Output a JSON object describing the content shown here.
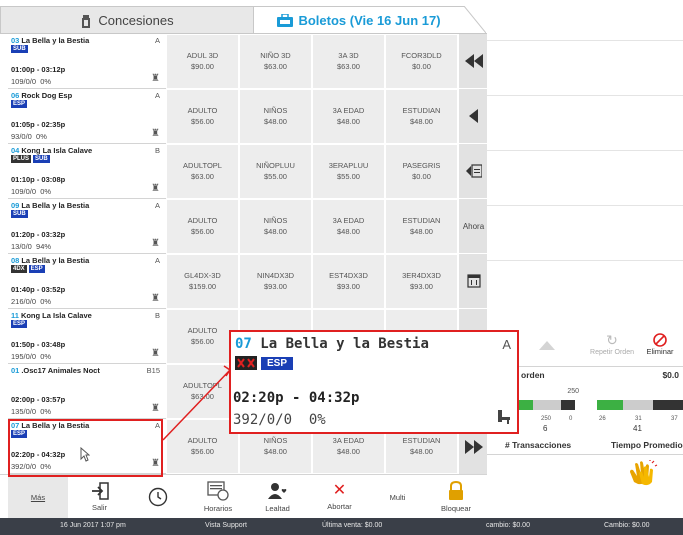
{
  "tabs": {
    "concessions": "Concesiones",
    "tickets": "Boletos (Vie 16 Jun 17)"
  },
  "showings": [
    {
      "num": "03",
      "title": "La Bella y la Bestia",
      "rating": "A",
      "tags": [
        "SUB"
      ],
      "time": "01:00p - 03:12p",
      "occupancy": "109/0/0  0%"
    },
    {
      "num": "06",
      "title": "Rock Dog Esp",
      "rating": "A",
      "tags": [
        "ESP"
      ],
      "time": "01:05p - 02:35p",
      "occupancy": "93/0/0  0%"
    },
    {
      "num": "04",
      "title": "Kong La Isla Calave",
      "rating": "B",
      "tags": [
        "PLUS",
        "SUB"
      ],
      "time": "01:10p - 03:08p",
      "occupancy": "109/0/0  0%"
    },
    {
      "num": "09",
      "title": "La Bella y la Bestia",
      "rating": "A",
      "tags": [
        "SUB"
      ],
      "time": "01:20p - 03:32p",
      "occupancy": "13/0/0  94%"
    },
    {
      "num": "08",
      "title": "La Bella y la Bestia",
      "rating": "A",
      "tags": [
        "4DX",
        "ESP"
      ],
      "time": "01:40p - 03:52p",
      "occupancy": "216/0/0  0%"
    },
    {
      "num": "11",
      "title": "Kong La Isla Calave",
      "rating": "B",
      "tags": [
        "ESP"
      ],
      "time": "01:50p - 03:48p",
      "occupancy": "195/0/0  0%"
    },
    {
      "num": "01",
      "title": ".Osc17 Animales Noct",
      "rating": "B15",
      "tags": [],
      "time": "02:00p - 03:57p",
      "occupancy": "135/0/0  0%"
    },
    {
      "num": "07",
      "title": "La Bella y la Bestia",
      "rating": "A",
      "tags": [
        "ESP"
      ],
      "time": "02:20p - 04:32p",
      "occupancy": "392/0/0  0%"
    }
  ],
  "prices": [
    [
      {
        "name": "ADUL 3D",
        "price": "$90.00"
      },
      {
        "name": "NIÑO 3D",
        "price": "$63.00"
      },
      {
        "name": "3A 3D",
        "price": "$63.00"
      },
      {
        "name": "FCOR3DLD",
        "price": "$0.00"
      }
    ],
    [
      {
        "name": "ADULTO",
        "price": "$56.00"
      },
      {
        "name": "NIÑOS",
        "price": "$48.00"
      },
      {
        "name": "3A EDAD",
        "price": "$48.00"
      },
      {
        "name": "ESTUDIAN",
        "price": "$48.00"
      }
    ],
    [
      {
        "name": "ADULTOPL",
        "price": "$63.00"
      },
      {
        "name": "NIÑOPLUU",
        "price": "$55.00"
      },
      {
        "name": "3ERAPLUU",
        "price": "$55.00"
      },
      {
        "name": "PASEGRIS",
        "price": "$0.00"
      }
    ],
    [
      {
        "name": "ADULTO",
        "price": "$56.00"
      },
      {
        "name": "NIÑOS",
        "price": "$48.00"
      },
      {
        "name": "3A EDAD",
        "price": "$48.00"
      },
      {
        "name": "ESTUDIAN",
        "price": "$48.00"
      }
    ],
    [
      {
        "name": "GL4DX-3D",
        "price": "$159.00"
      },
      {
        "name": "NIN4DX3D",
        "price": "$93.00"
      },
      {
        "name": "EST4DX3D",
        "price": "$93.00"
      },
      {
        "name": "3ER4DX3D",
        "price": "$93.00"
      }
    ],
    [
      {
        "name": "ADULTO",
        "price": "$56.00"
      }
    ],
    [
      {
        "name": "ADULTOPL",
        "price": "$63.00"
      }
    ],
    [
      {
        "name": "ADULTO",
        "price": "$56.00"
      },
      {
        "name": "NIÑOS",
        "price": "$48.00"
      },
      {
        "name": "3A EDAD",
        "price": "$48.00"
      },
      {
        "name": "ESTUDIAN",
        "price": "$48.00"
      }
    ]
  ],
  "nav": {
    "now": "Ahora"
  },
  "toolbar": {
    "more": "Más",
    "exit": "Salir",
    "schedules": "Horarios",
    "loyalty": "Lealtad",
    "abort": "Abortar",
    "multi": "Multi",
    "lock": "Bloquear"
  },
  "status": {
    "datetime": "16 Jun 2017 1:07 pm",
    "support": "Vista Support",
    "last_sale": "Última venta: $0.00",
    "change1": "cambio: $0.00",
    "change2": "Cambio: $0.00"
  },
  "right": {
    "repeat_order": "Repetir Orden",
    "delete": "Eliminar",
    "order": "orden",
    "total": "$0.0",
    "transactions": "# Transacciones",
    "avg_time": "Tiempo Promedio",
    "g1_max": "250",
    "g1_v1": "250",
    "g1_v2": "0",
    "g1_count": "6",
    "g2_a": "26",
    "g2_b": "31",
    "g2_c": "37",
    "g2_count": "41"
  },
  "popup": {
    "num": "07",
    "title": "La Bella y la Bestia",
    "rating": "A",
    "tag": "ESP",
    "time": "02:20p - 04:32p",
    "occupancy": "392/0/0  0%"
  },
  "colors": {
    "accent": "#1a9bd7",
    "highlight": "#e02020",
    "status_bar": "#3a3f48"
  }
}
